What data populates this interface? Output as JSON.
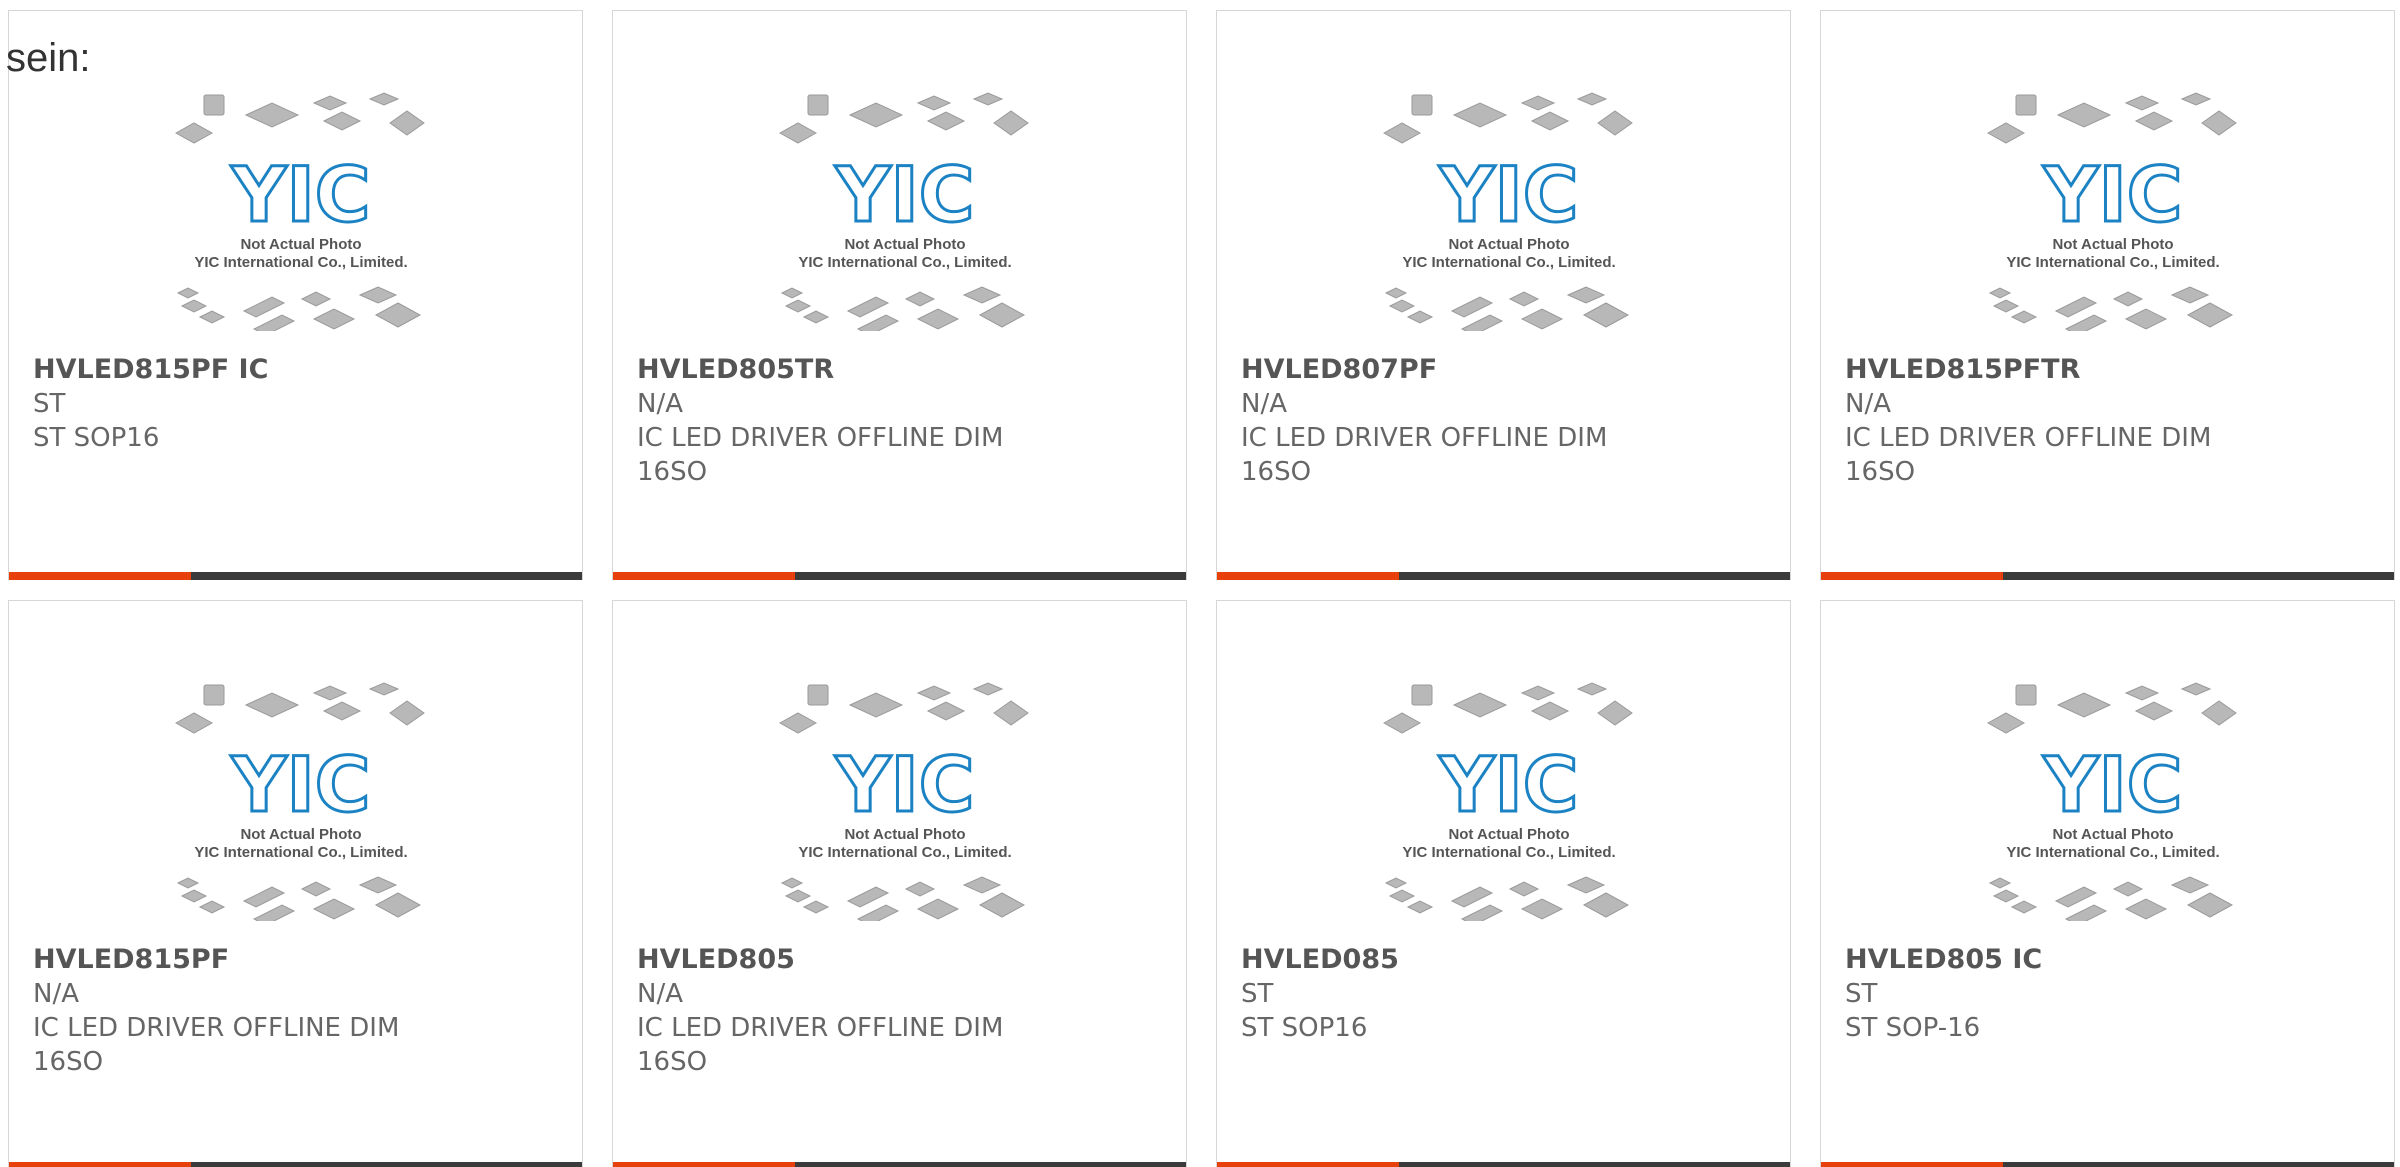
{
  "intro": {
    "label": "sein:"
  },
  "placeholder": {
    "line1": "Not Actual Photo",
    "line2": "YIC International Co., Limited.",
    "logo_text": "YIC",
    "logo_color": "#1b82c4",
    "chip_color": "#b8b8b8"
  },
  "colors": {
    "accent": "#e8400a",
    "bar": "#3b3b3b"
  },
  "products": [
    {
      "part": "HVLED815PF IC",
      "brand": "ST",
      "desc": "ST SOP16"
    },
    {
      "part": "HVLED805TR",
      "brand": "N/A",
      "desc": "IC LED DRIVER OFFLINE DIM 16SO"
    },
    {
      "part": "HVLED807PF",
      "brand": "N/A",
      "desc": "IC LED DRIVER OFFLINE DIM 16SO"
    },
    {
      "part": "HVLED815PFTR",
      "brand": "N/A",
      "desc": "IC LED DRIVER OFFLINE DIM 16SO"
    },
    {
      "part": "HVLED815PF",
      "brand": "N/A",
      "desc": "IC LED DRIVER OFFLINE DIM 16SO"
    },
    {
      "part": "HVLED805",
      "brand": "N/A",
      "desc": "IC LED DRIVER OFFLINE DIM 16SO"
    },
    {
      "part": "HVLED085",
      "brand": "ST",
      "desc": "ST SOP16"
    },
    {
      "part": "HVLED805 IC",
      "brand": "ST",
      "desc": "ST SOP-16"
    }
  ]
}
